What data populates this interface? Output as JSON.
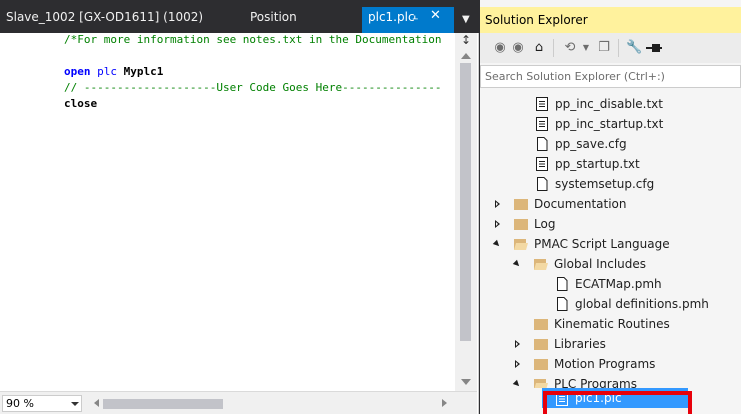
{
  "editor": {
    "tabs": {
      "slave": "Slave_1002 [GX-OD1611] (1002)",
      "position": "Position",
      "active": "plc1.plc"
    },
    "code_lines": {
      "line1": "/*For more information see notes.txt in the Documentation",
      "line2_kw": "open",
      "line2_kw2": "plc",
      "line2_name": "Myplc1",
      "line3": "// --------------------User Code Goes Here---------------",
      "line4": "close"
    },
    "zoom": "90 %"
  },
  "solution_explorer": {
    "title": "Solution Explorer",
    "search_placeholder": "Search Solution Explorer (Ctrl+:)",
    "items": [
      {
        "label": "pp_inc_disable.txt",
        "icon": "text-file-icon"
      },
      {
        "label": "pp_inc_startup.txt",
        "icon": "text-file-icon"
      },
      {
        "label": "pp_save.cfg",
        "icon": "file-icon"
      },
      {
        "label": "pp_startup.txt",
        "icon": "text-file-icon"
      },
      {
        "label": "systemsetup.cfg",
        "icon": "file-icon"
      },
      {
        "label": "Documentation",
        "icon": "folder-icon",
        "expanded": false
      },
      {
        "label": "Log",
        "icon": "folder-icon",
        "expanded": false
      },
      {
        "label": "PMAC Script Language",
        "icon": "folder-open-icon",
        "expanded": true
      },
      {
        "label": "Global Includes",
        "icon": "folder-open-icon",
        "expanded": true
      },
      {
        "label": "ECATMap.pmh",
        "icon": "file-icon"
      },
      {
        "label": "global definitions.pmh",
        "icon": "file-icon"
      },
      {
        "label": "Kinematic Routines",
        "icon": "folder-icon"
      },
      {
        "label": "Libraries",
        "icon": "folder-icon",
        "expanded": false
      },
      {
        "label": "Motion Programs",
        "icon": "folder-icon",
        "expanded": false
      },
      {
        "label": "PLC Programs",
        "icon": "folder-open-icon",
        "expanded": true
      },
      {
        "label": "plc1.plc",
        "icon": "text-file-icon",
        "selected": true
      }
    ]
  },
  "colors": {
    "accent": "#007acc",
    "header_highlight": "#fff29d",
    "selection": "#3399ff",
    "callout": "#e8000b",
    "folder": "#dcb67a"
  }
}
